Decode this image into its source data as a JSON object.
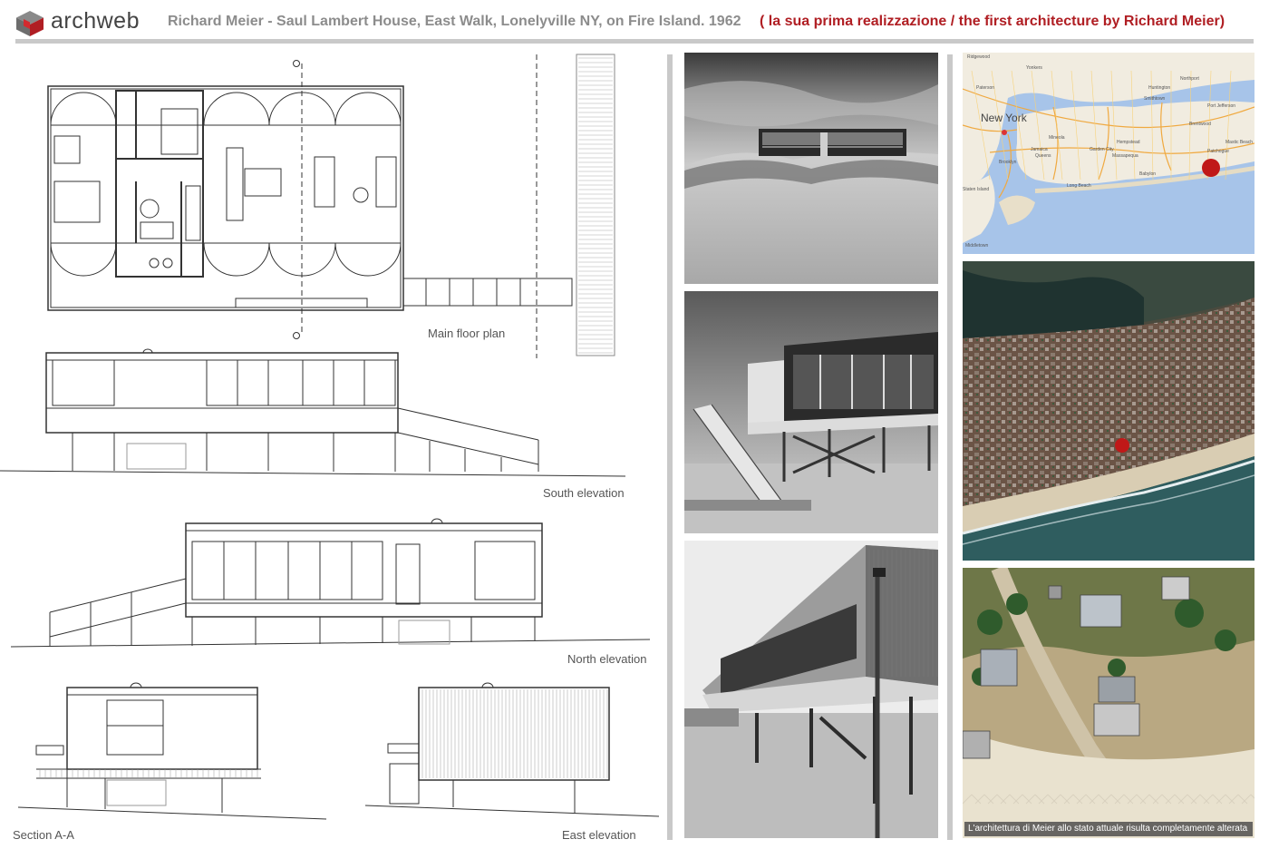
{
  "header": {
    "logo_text": "archweb",
    "title": "Richard Meier - Saul Lambert House, East Walk, Lonelyville NY, on Fire Island. 1962",
    "subtitle": "( la sua prima realizzazione  /  the first architecture by Richard Meier)"
  },
  "drawings": {
    "main_floor_plan": "Main floor plan",
    "south_elevation": "South elevation",
    "north_elevation": "North elevation",
    "section_aa": "Section A-A",
    "east_elevation": "East elevation"
  },
  "map": {
    "city_label": "New York",
    "places": [
      "Ridgewood",
      "Yonkers",
      "Paterson",
      "Huntington",
      "Northport",
      "Smithtown",
      "Mineola",
      "Hempstead",
      "Jamaica",
      "Brooklyn",
      "Queens",
      "Staten Island",
      "Middletown",
      "Garden City",
      "Long Beach",
      "Massapequa",
      "Babylon",
      "Brentwood",
      "Patchogue",
      "Port Jefferson",
      "Mastic Beach"
    ]
  },
  "aerial_caption": "L'architettura di Meier allo stato attuale risulta completamente alterata",
  "colors": {
    "accent_red": "#b01e23",
    "title_gray": "#8c8c8c",
    "rule_gray": "#c9c9c9"
  }
}
